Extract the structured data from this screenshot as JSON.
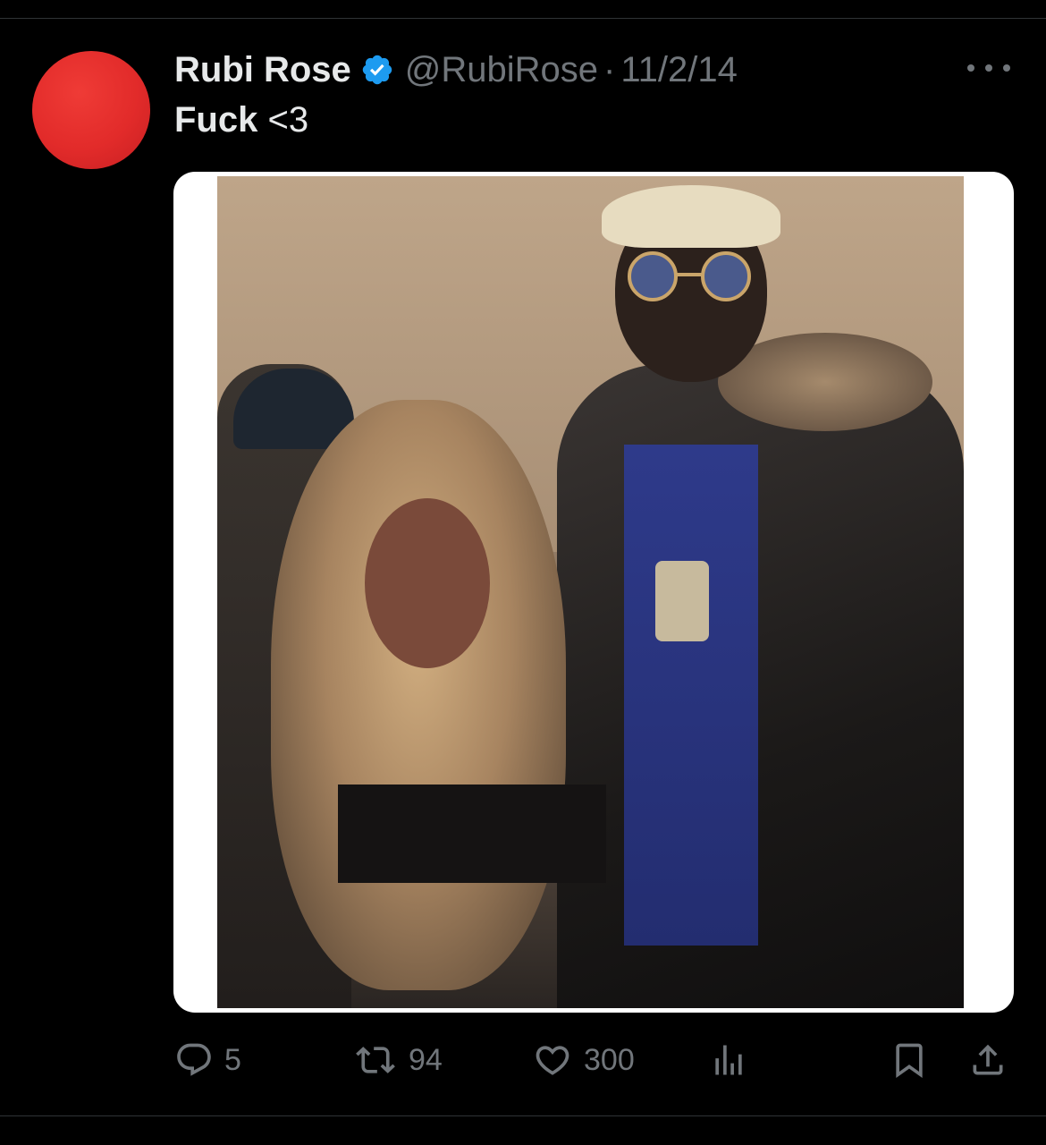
{
  "tweet": {
    "author_name": "Rubi Rose",
    "handle": "@RubiRose",
    "separator": "·",
    "date": "11/2/14",
    "text_bold": "Fuck",
    "text_rest": " <3",
    "avatar_color": "#e22b2a",
    "verified_color": "#1d9bf0"
  },
  "actions": {
    "reply_count": "5",
    "retweet_count": "94",
    "like_count": "300",
    "icons": {
      "reply": "reply-icon",
      "retweet": "retweet-icon",
      "like": "heart-icon",
      "views": "bar-chart-icon",
      "bookmark": "bookmark-icon",
      "share": "share-icon"
    }
  },
  "colors": {
    "background": "#000000",
    "primary_text": "#e7e9ea",
    "secondary_text": "#71767b"
  }
}
